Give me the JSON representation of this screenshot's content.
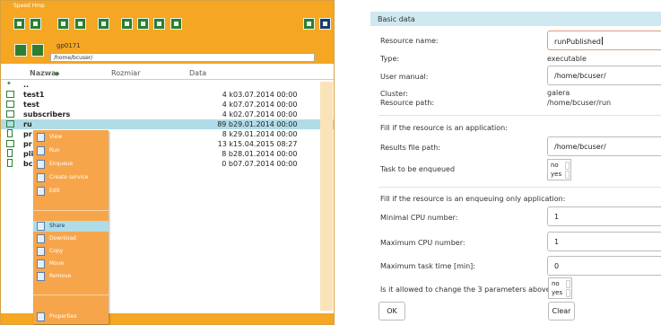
{
  "file_manager": {
    "title": "Speed Hmp",
    "user": "gp0171",
    "path": "/home/bcuser/",
    "columns": {
      "name": "Nazwa",
      "size": "Rozmiar",
      "date": "Data"
    },
    "sort_icon": "sort-up-icon",
    "rows": [
      {
        "name": "..",
        "size": "",
        "date": "",
        "icon": "folder-up-icon"
      },
      {
        "name": "test1",
        "size": "4 k",
        "date": "03.07.2014 00:00",
        "icon": "folder-icon"
      },
      {
        "name": "test",
        "size": "4 k",
        "date": "07.07.2014 00:00",
        "icon": "folder-icon"
      },
      {
        "name": "subscribers",
        "size": "4 k",
        "date": "02.07.2014 00:00",
        "icon": "folder-icon"
      },
      {
        "name": "ru",
        "size": "89 b",
        "date": "29.01.2014 00:00",
        "icon": "executable-icon"
      },
      {
        "name": "pr",
        "size": "8 k",
        "date": "29.01.2014 00:00",
        "icon": "file-icon"
      },
      {
        "name": "pr",
        "size": "13 k",
        "date": "15.04.2015 08:27",
        "icon": "executable-icon"
      },
      {
        "name": "pli",
        "size": "8 b",
        "date": "28.01.2014 00:00",
        "icon": "file-icon"
      },
      {
        "name": "bc",
        "size": "0 b",
        "date": "07.07.2014 00:00",
        "icon": "file-icon"
      }
    ],
    "context_menu": {
      "items_top": [
        "View",
        "Run",
        "Enqueue",
        "Create service",
        "Edit"
      ],
      "items_mid": [
        "Share",
        "Download",
        "Copy",
        "Move",
        "Remove"
      ],
      "item_bottom": "Properties"
    }
  },
  "form": {
    "header": "Basic data",
    "resource_name_label": "Resource name:",
    "resource_name_value": "runPublished",
    "type_label": "Type:",
    "type_value": "executable",
    "user_manual_label": "User manual:",
    "user_manual_value": "/home/bcuser/",
    "cluster_label": "Cluster:",
    "cluster_value": "galera",
    "resource_path_label": "Resource path:",
    "resource_path_value": "/home/bcuser/run",
    "section_app": "Fill if the resource is an application:",
    "results_path_label": "Results file path:",
    "results_path_value": "/home/bcuser/",
    "enqueue_label": "Task to be enqueued",
    "enqueue_options": [
      "no",
      "yes"
    ],
    "section_enqueue": "Fill if the resource is an enqueuing only application:",
    "min_cpu_label": "Minimal CPU number:",
    "min_cpu_value": "1",
    "max_cpu_label": "Maximum CPU number:",
    "max_cpu_value": "1",
    "max_time_label": "Maximum task time [min]:",
    "max_time_value": "0",
    "allow_change_label": "Is it allowed to change the 3 parameters above?",
    "allow_change_options": [
      "no",
      "yes"
    ],
    "ok_label": "OK",
    "clear_label": "Clear"
  },
  "colors": {
    "accent": "#f5a623",
    "selection": "#b0dce8",
    "header": "#cfe8ef",
    "icon": "#2e7d32"
  }
}
